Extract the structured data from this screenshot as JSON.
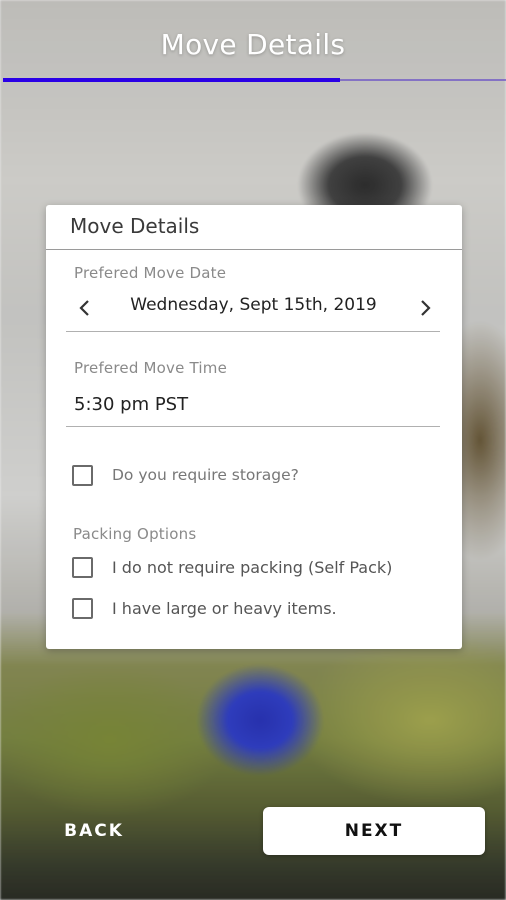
{
  "header": {
    "title": "Move Details",
    "progress_percent": 67,
    "progress_color": "#2a00e6"
  },
  "card": {
    "title": "Move Details",
    "date_field": {
      "label": "Prefered Move Date",
      "value": "Wednesday, Sept 15th, 2019",
      "prev_icon": "chevron-left-icon",
      "next_icon": "chevron-right-icon"
    },
    "time_field": {
      "label": "Prefered Move Time",
      "value": "5:30 pm PST"
    },
    "storage_checkbox": {
      "label": "Do you require storage?",
      "checked": false
    },
    "packing": {
      "label": "Packing Options",
      "options": [
        {
          "label": "I do not require packing (Self Pack)",
          "checked": false
        },
        {
          "label": "I have large or heavy items.",
          "checked": false
        }
      ]
    }
  },
  "footer": {
    "back_label": "BACK",
    "next_label": "NEXT"
  }
}
